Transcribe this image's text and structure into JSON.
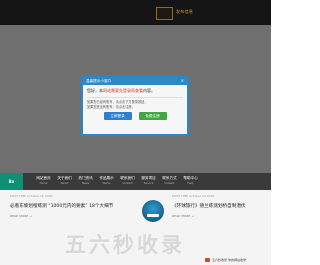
{
  "top_bar": {
    "links": "发布信息"
  },
  "modal": {
    "title": "温馨提示小窗口",
    "close": "×",
    "lead_prefix": "您好，本",
    "lead_highlight": "网站需要先登录再查看",
    "lead_suffix": "内容。",
    "para1": "如果您已经有账号，请点击下方登录按钮，",
    "para2": "如果您还没有账号，请点击注册。",
    "login_label": "立即登录",
    "register_label": "免费注册"
  },
  "nav": {
    "logo": "Ba",
    "items": [
      {
        "zh": "网站首页",
        "en": "Home"
      },
      {
        "zh": "关于我们",
        "en": "About"
      },
      {
        "zh": "热门资讯",
        "en": "News"
      },
      {
        "zh": "作品展示",
        "en": "Works"
      },
      {
        "zh": "联系我们",
        "en": "Contact"
      },
      {
        "zh": "服务项目",
        "en": "Service"
      },
      {
        "zh": "联系方式",
        "en": "Contact"
      },
      {
        "zh": "帮助中心",
        "en": "Help"
      }
    ]
  },
  "cards": [
    {
      "meta": "POST TIME October 16 2020",
      "title": "必看东黎划橙练测 “1000元内的要素” 18个大细节",
      "more": "READ MORE →"
    },
    {
      "meta": "POST TIME October 14 2020",
      "title": "《环球旅行》德兰练测划桥自制潜伏",
      "more": "READ MORE →"
    }
  ],
  "watermark": "五六秒收录",
  "footer_note": "五六秒收录 你的网站收录"
}
